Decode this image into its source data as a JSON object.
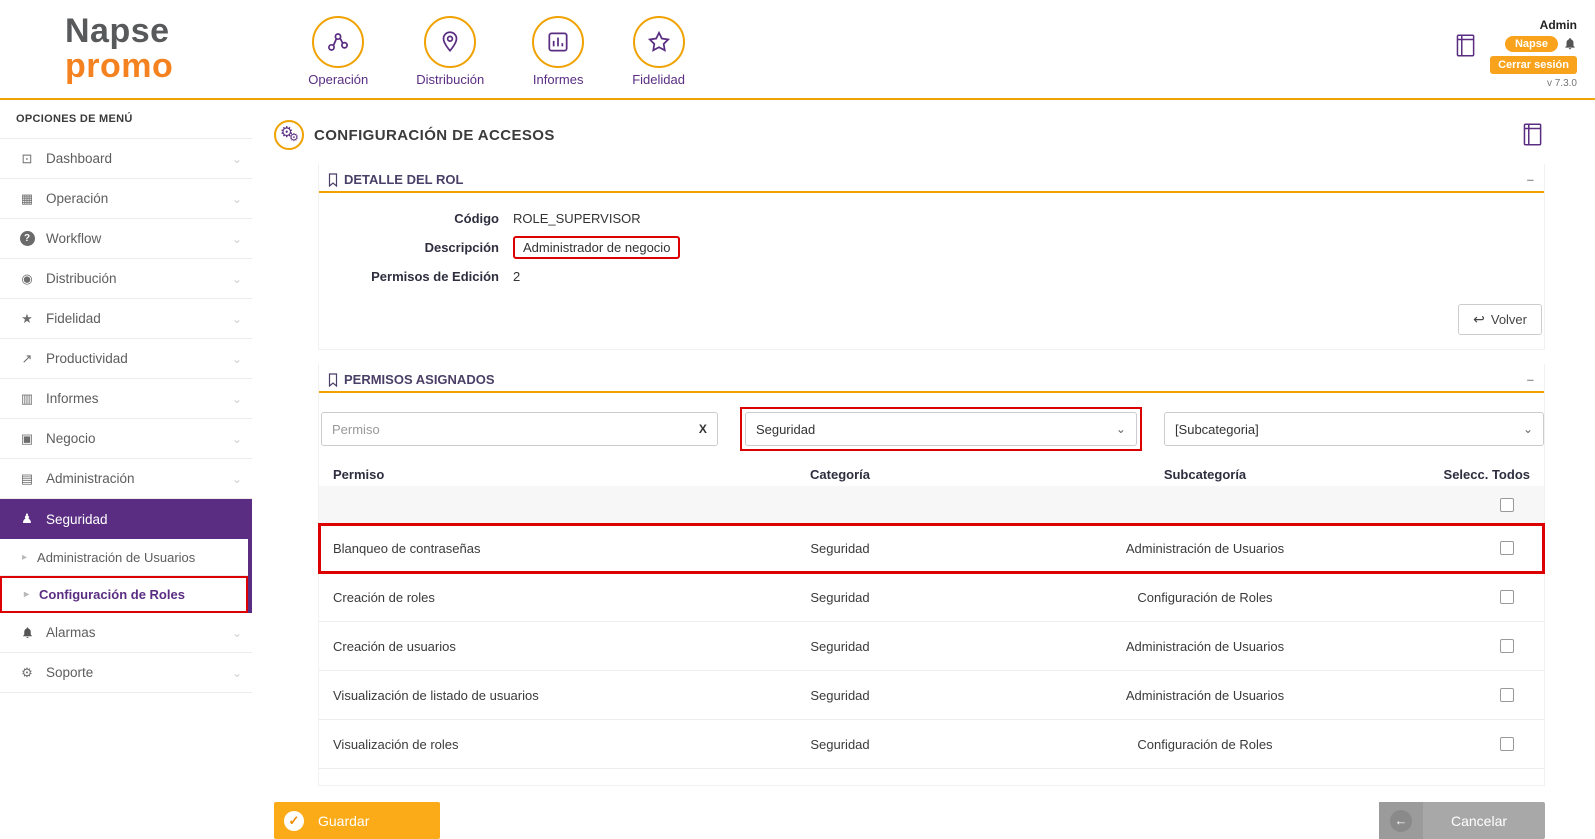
{
  "header": {
    "logo_line1": "Napse",
    "logo_line2": "promo",
    "nav": [
      {
        "label": "Operación"
      },
      {
        "label": "Distribución"
      },
      {
        "label": "Informes"
      },
      {
        "label": "Fidelidad"
      }
    ],
    "user": {
      "name": "Admin",
      "badge": "Napse",
      "logout_label": "Cerrar sesión",
      "version": "v 7.3.0"
    }
  },
  "sidebar": {
    "title": "OPCIONES DE MENÚ",
    "items": [
      {
        "label": "Dashboard"
      },
      {
        "label": "Operación"
      },
      {
        "label": "Workflow"
      },
      {
        "label": "Distribución"
      },
      {
        "label": "Fidelidad"
      },
      {
        "label": "Productividad"
      },
      {
        "label": "Informes"
      },
      {
        "label": "Negocio"
      },
      {
        "label": "Administración"
      },
      {
        "label": "Seguridad"
      },
      {
        "label": "Administración de Usuarios"
      },
      {
        "label": "Configuración de Roles"
      },
      {
        "label": "Alarmas"
      },
      {
        "label": "Soporte"
      }
    ]
  },
  "main": {
    "page_title": "CONFIGURACIÓN DE ACCESOS",
    "detail_panel": {
      "title": "DETALLE DEL ROL",
      "minimize": "–",
      "fields": [
        {
          "label": "Código",
          "value": "ROLE_SUPERVISOR"
        },
        {
          "label": "Descripción",
          "value": "Administrador de negocio"
        },
        {
          "label": "Permisos de Edición",
          "value": "2"
        }
      ],
      "volver_label": "Volver"
    },
    "permissions": {
      "title": "PERMISOS ASIGNADOS",
      "minimize": "–",
      "filters": {
        "permiso_placeholder": "Permiso",
        "clear_label": "X",
        "categoria_value": "Seguridad",
        "subcategoria_value": "[Subcategoria]"
      },
      "headers": {
        "permiso": "Permiso",
        "categoria": "Categoría",
        "subcategoria": "Subcategoría",
        "select_all": "Selecc. Todos"
      },
      "rows": [
        {
          "permiso": "Blanqueo de contraseñas",
          "categoria": "Seguridad",
          "subcategoria": "Administración de Usuarios"
        },
        {
          "permiso": "Creación de roles",
          "categoria": "Seguridad",
          "subcategoria": "Configuración de Roles"
        },
        {
          "permiso": "Creación de usuarios",
          "categoria": "Seguridad",
          "subcategoria": "Administración de Usuarios"
        },
        {
          "permiso": "Visualización de listado de usuarios",
          "categoria": "Seguridad",
          "subcategoria": "Administración de Usuarios"
        },
        {
          "permiso": "Visualización de roles",
          "categoria": "Seguridad",
          "subcategoria": "Configuración de Roles"
        }
      ]
    },
    "actions": {
      "save_label": "Guardar",
      "cancel_label": "Cancelar"
    }
  },
  "icons": {
    "gear": "⚙",
    "chevron_down": "⌄",
    "sub_arrow": "▸",
    "back_arrow": "↩",
    "left_arrow": "←",
    "check": "✓",
    "dashboard": "⊡",
    "operacion": "▦",
    "workflow_q": "?",
    "pin": "◉",
    "star": "★",
    "productividad": "↗",
    "informes": "▥",
    "negocio": "▣",
    "administracion": "▤",
    "seguridad": "♟",
    "soporte": "⚙"
  },
  "colors": {
    "purple": "#5a2d82",
    "orange": "#f0a202",
    "highlight_red": "#dd0000"
  }
}
